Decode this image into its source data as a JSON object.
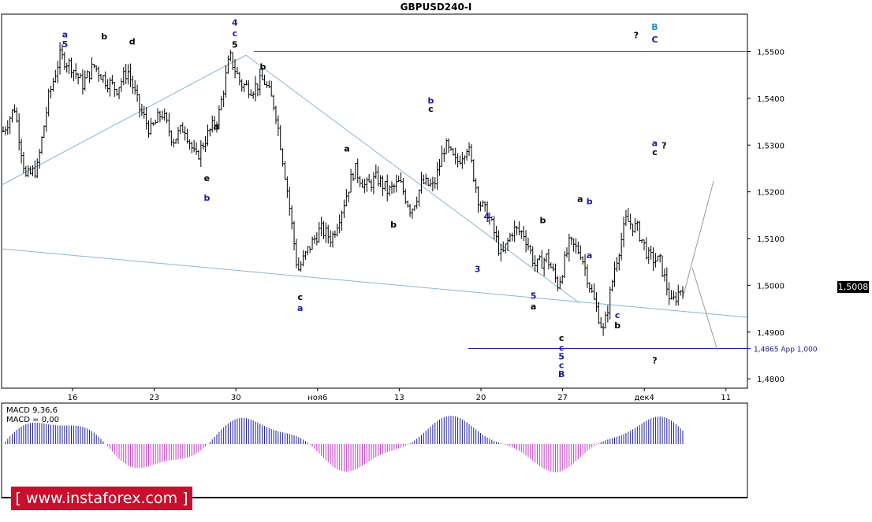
{
  "title": "GBPUSD240-I",
  "current_price": "1,5008",
  "watermark": "[ www.instaforex.com ]",
  "colors": {
    "candles": "#000000",
    "trendline": "#87b7d7",
    "resistance": "#c0392b",
    "support": "#1a1a8c",
    "macd_pos": "#1a1aa8",
    "macd_neg": "#cc33cc",
    "projection": "#999999",
    "label_blue": "#1a1aa8",
    "label_cyan": "#1e90c8"
  },
  "macd": {
    "label1": "MACD 9,36,6",
    "label2": "MACD = 0,00"
  },
  "chart_data": {
    "type": "candlestick",
    "symbol": "GBPUSD240-I",
    "yticks": [
      "1,5500",
      "1,5400",
      "1,5300",
      "1,5200",
      "1,5100",
      "1,5000",
      "1,4900",
      "1,4800"
    ],
    "xticks": [
      "16",
      "23",
      "30",
      "ноя6",
      "13",
      "20",
      "27",
      "дек4",
      "11"
    ],
    "ylim": [
      1.478,
      1.558
    ],
    "last_price": 1.5008,
    "close_path": [
      {
        "t": 0,
        "p": 1.533
      },
      {
        "t": 1,
        "p": 1.538
      },
      {
        "t": 2,
        "p": 1.523
      },
      {
        "t": 3,
        "p": 1.525
      },
      {
        "t": 4,
        "p": 1.54
      },
      {
        "t": 5,
        "p": 1.549
      },
      {
        "t": 6,
        "p": 1.547
      },
      {
        "t": 7,
        "p": 1.543
      },
      {
        "t": 8,
        "p": 1.547
      },
      {
        "t": 9,
        "p": 1.544
      },
      {
        "t": 10,
        "p": 1.542
      },
      {
        "t": 11,
        "p": 1.546
      },
      {
        "t": 12,
        "p": 1.538
      },
      {
        "t": 13,
        "p": 1.533
      },
      {
        "t": 14,
        "p": 1.537
      },
      {
        "t": 15,
        "p": 1.531
      },
      {
        "t": 16,
        "p": 1.534
      },
      {
        "t": 17,
        "p": 1.527
      },
      {
        "t": 18,
        "p": 1.532
      },
      {
        "t": 19,
        "p": 1.536
      },
      {
        "t": 20,
        "p": 1.549
      },
      {
        "t": 21,
        "p": 1.543
      },
      {
        "t": 22,
        "p": 1.542
      },
      {
        "t": 23,
        "p": 1.544
      },
      {
        "t": 24,
        "p": 1.538
      },
      {
        "t": 25,
        "p": 1.522
      },
      {
        "t": 26,
        "p": 1.503
      },
      {
        "t": 27,
        "p": 1.508
      },
      {
        "t": 28,
        "p": 1.512
      },
      {
        "t": 29,
        "p": 1.51
      },
      {
        "t": 30,
        "p": 1.517
      },
      {
        "t": 31,
        "p": 1.525
      },
      {
        "t": 32,
        "p": 1.521
      },
      {
        "t": 33,
        "p": 1.523
      },
      {
        "t": 34,
        "p": 1.52
      },
      {
        "t": 35,
        "p": 1.522
      },
      {
        "t": 36,
        "p": 1.516
      },
      {
        "t": 37,
        "p": 1.522
      },
      {
        "t": 38,
        "p": 1.521
      },
      {
        "t": 39,
        "p": 1.53
      },
      {
        "t": 40,
        "p": 1.526
      },
      {
        "t": 41,
        "p": 1.53
      },
      {
        "t": 42,
        "p": 1.518
      },
      {
        "t": 43,
        "p": 1.514
      },
      {
        "t": 44,
        "p": 1.506
      },
      {
        "t": 45,
        "p": 1.512
      },
      {
        "t": 46,
        "p": 1.511
      },
      {
        "t": 47,
        "p": 1.504
      },
      {
        "t": 48,
        "p": 1.506
      },
      {
        "t": 49,
        "p": 1.5
      },
      {
        "t": 50,
        "p": 1.509
      },
      {
        "t": 51,
        "p": 1.507
      },
      {
        "t": 52,
        "p": 1.498
      },
      {
        "t": 53,
        "p": 1.49
      },
      {
        "t": 54,
        "p": 1.504
      },
      {
        "t": 55,
        "p": 1.514
      },
      {
        "t": 56,
        "p": 1.512
      },
      {
        "t": 57,
        "p": 1.506
      },
      {
        "t": 58,
        "p": 1.505
      },
      {
        "t": 59,
        "p": 1.496
      },
      {
        "t": 60,
        "p": 1.5
      }
    ],
    "levels": [
      {
        "name": "resistance",
        "value": 1.55
      },
      {
        "name": "support",
        "value": 1.4865,
        "label": "1,4865 App 1,000"
      }
    ],
    "annotations": [
      {
        "text": "B",
        "x": 0.7,
        "y": 1.5553,
        "color": "cyan"
      },
      {
        "text": "C",
        "x": 0.7,
        "y": 1.5526,
        "color": "blue"
      },
      {
        "text": "?",
        "x": 0.68,
        "y": 1.5535,
        "color": "black"
      },
      {
        "text": "a",
        "x": 0.068,
        "y": 1.5537,
        "color": "blue"
      },
      {
        "text": "5",
        "x": 0.068,
        "y": 1.5516,
        "color": "blue"
      },
      {
        "text": "b",
        "x": 0.11,
        "y": 1.5533,
        "color": "black"
      },
      {
        "text": "d",
        "x": 0.14,
        "y": 1.5522,
        "color": "black"
      },
      {
        "text": "4",
        "x": 0.25,
        "y": 1.5562,
        "color": "blue"
      },
      {
        "text": "c",
        "x": 0.25,
        "y": 1.554,
        "color": "blue"
      },
      {
        "text": "5",
        "x": 0.25,
        "y": 1.5515,
        "color": "black"
      },
      {
        "text": "b",
        "x": 0.28,
        "y": 1.5468,
        "color": "black"
      },
      {
        "text": "a",
        "x": 0.23,
        "y": 1.534,
        "color": "black"
      },
      {
        "text": "e",
        "x": 0.22,
        "y": 1.523,
        "color": "black"
      },
      {
        "text": "b",
        "x": 0.22,
        "y": 1.5188,
        "color": "blue"
      },
      {
        "text": "c",
        "x": 0.32,
        "y": 1.4975,
        "color": "black"
      },
      {
        "text": "a",
        "x": 0.32,
        "y": 1.4952,
        "color": "blue"
      },
      {
        "text": "a",
        "x": 0.37,
        "y": 1.5293,
        "color": "black"
      },
      {
        "text": "b",
        "x": 0.42,
        "y": 1.513,
        "color": "black"
      },
      {
        "text": "b",
        "x": 0.46,
        "y": 1.5396,
        "color": "blue"
      },
      {
        "text": "c",
        "x": 0.46,
        "y": 1.5378,
        "color": "black"
      },
      {
        "text": "4",
        "x": 0.52,
        "y": 1.5148,
        "color": "blue"
      },
      {
        "text": "3",
        "x": 0.51,
        "y": 1.5035,
        "color": "blue"
      },
      {
        "text": "5",
        "x": 0.57,
        "y": 1.4978,
        "color": "blue"
      },
      {
        "text": "a",
        "x": 0.57,
        "y": 1.4955,
        "color": "black"
      },
      {
        "text": "b",
        "x": 0.58,
        "y": 1.514,
        "color": "black"
      },
      {
        "text": "c",
        "x": 0.6,
        "y": 1.4888,
        "color": "black"
      },
      {
        "text": "c",
        "x": 0.6,
        "y": 1.4867,
        "color": "blue"
      },
      {
        "text": "5",
        "x": 0.6,
        "y": 1.4848,
        "color": "blue"
      },
      {
        "text": "c",
        "x": 0.6,
        "y": 1.483,
        "color": "blue"
      },
      {
        "text": "B",
        "x": 0.6,
        "y": 1.481,
        "color": "blue"
      },
      {
        "text": "a",
        "x": 0.62,
        "y": 1.5185,
        "color": "black"
      },
      {
        "text": "b",
        "x": 0.63,
        "y": 1.518,
        "color": "blue"
      },
      {
        "text": "a",
        "x": 0.63,
        "y": 1.5065,
        "color": "blue"
      },
      {
        "text": "c",
        "x": 0.66,
        "y": 1.4937,
        "color": "blue"
      },
      {
        "text": "b",
        "x": 0.66,
        "y": 1.4915,
        "color": "black"
      },
      {
        "text": "a",
        "x": 0.7,
        "y": 1.5305,
        "color": "blue"
      },
      {
        "text": "c",
        "x": 0.7,
        "y": 1.5285,
        "color": "black"
      },
      {
        "text": "?",
        "x": 0.71,
        "y": 1.53,
        "color": "black"
      },
      {
        "text": "?",
        "x": 0.7,
        "y": 1.484,
        "color": "black"
      }
    ]
  }
}
